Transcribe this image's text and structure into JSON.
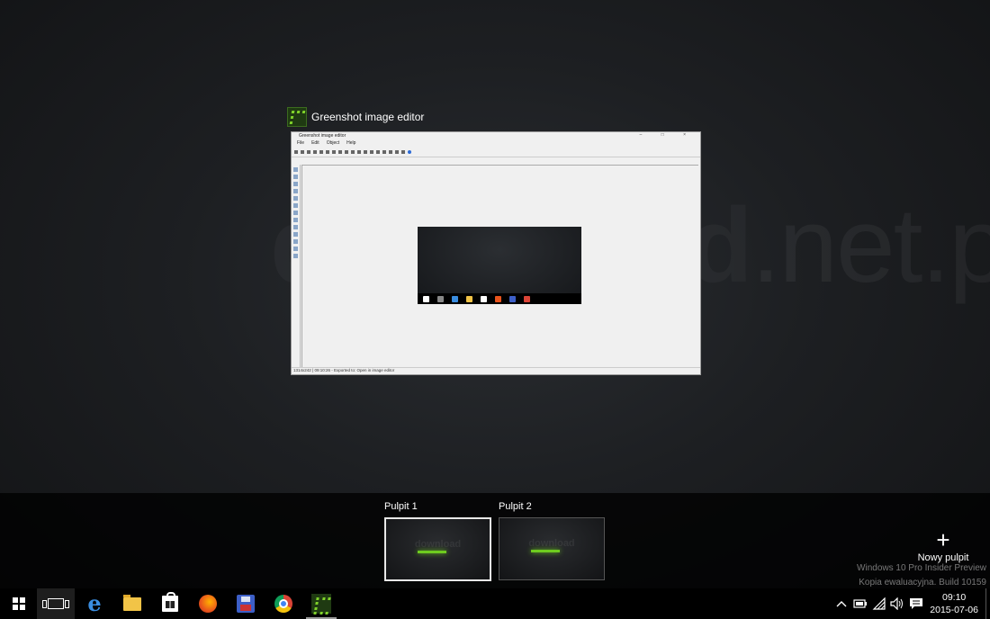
{
  "background_watermark": {
    "text": "download",
    "suffix": ".net.pl"
  },
  "window": {
    "title": "Greenshot image editor"
  },
  "thumbnail": {
    "title": "Greenshot image editor",
    "window_controls": "– □ ×",
    "menu": [
      "File",
      "Edit",
      "Object",
      "Help"
    ],
    "status": "1314x242 | 09:10:26 - Exported to: Open in image editor"
  },
  "desktops": [
    {
      "label": "Pulpit 1",
      "active": true
    },
    {
      "label": "Pulpit 2",
      "active": false
    }
  ],
  "new_desktop": {
    "icon": "plus-icon",
    "label": "Nowy pulpit"
  },
  "system_watermark": {
    "line1": "Windows 10 Pro Insider Preview",
    "line2": "Kopia ewaluacyjna. Build 10159"
  },
  "taskbar": {
    "apps": [
      {
        "name": "start",
        "icon": "windows-logo-icon"
      },
      {
        "name": "task-view",
        "icon": "task-view-icon"
      },
      {
        "name": "edge",
        "icon": "edge-icon"
      },
      {
        "name": "file-explorer",
        "icon": "folder-icon"
      },
      {
        "name": "store",
        "icon": "store-icon"
      },
      {
        "name": "firefox",
        "icon": "firefox-icon"
      },
      {
        "name": "save-app",
        "icon": "floppy-icon"
      },
      {
        "name": "chrome",
        "icon": "chrome-icon"
      },
      {
        "name": "greenshot",
        "icon": "greenshot-icon"
      }
    ],
    "tray_icons": [
      "chevron-up-icon",
      "battery-icon",
      "wifi-icon",
      "volume-icon",
      "action-center-icon"
    ],
    "clock": {
      "time": "09:10",
      "date": "2015-07-06"
    }
  },
  "colors": {
    "accent_green": "#6ecb1f",
    "taskbar": "#000000",
    "strip": "#0a0a0a"
  }
}
